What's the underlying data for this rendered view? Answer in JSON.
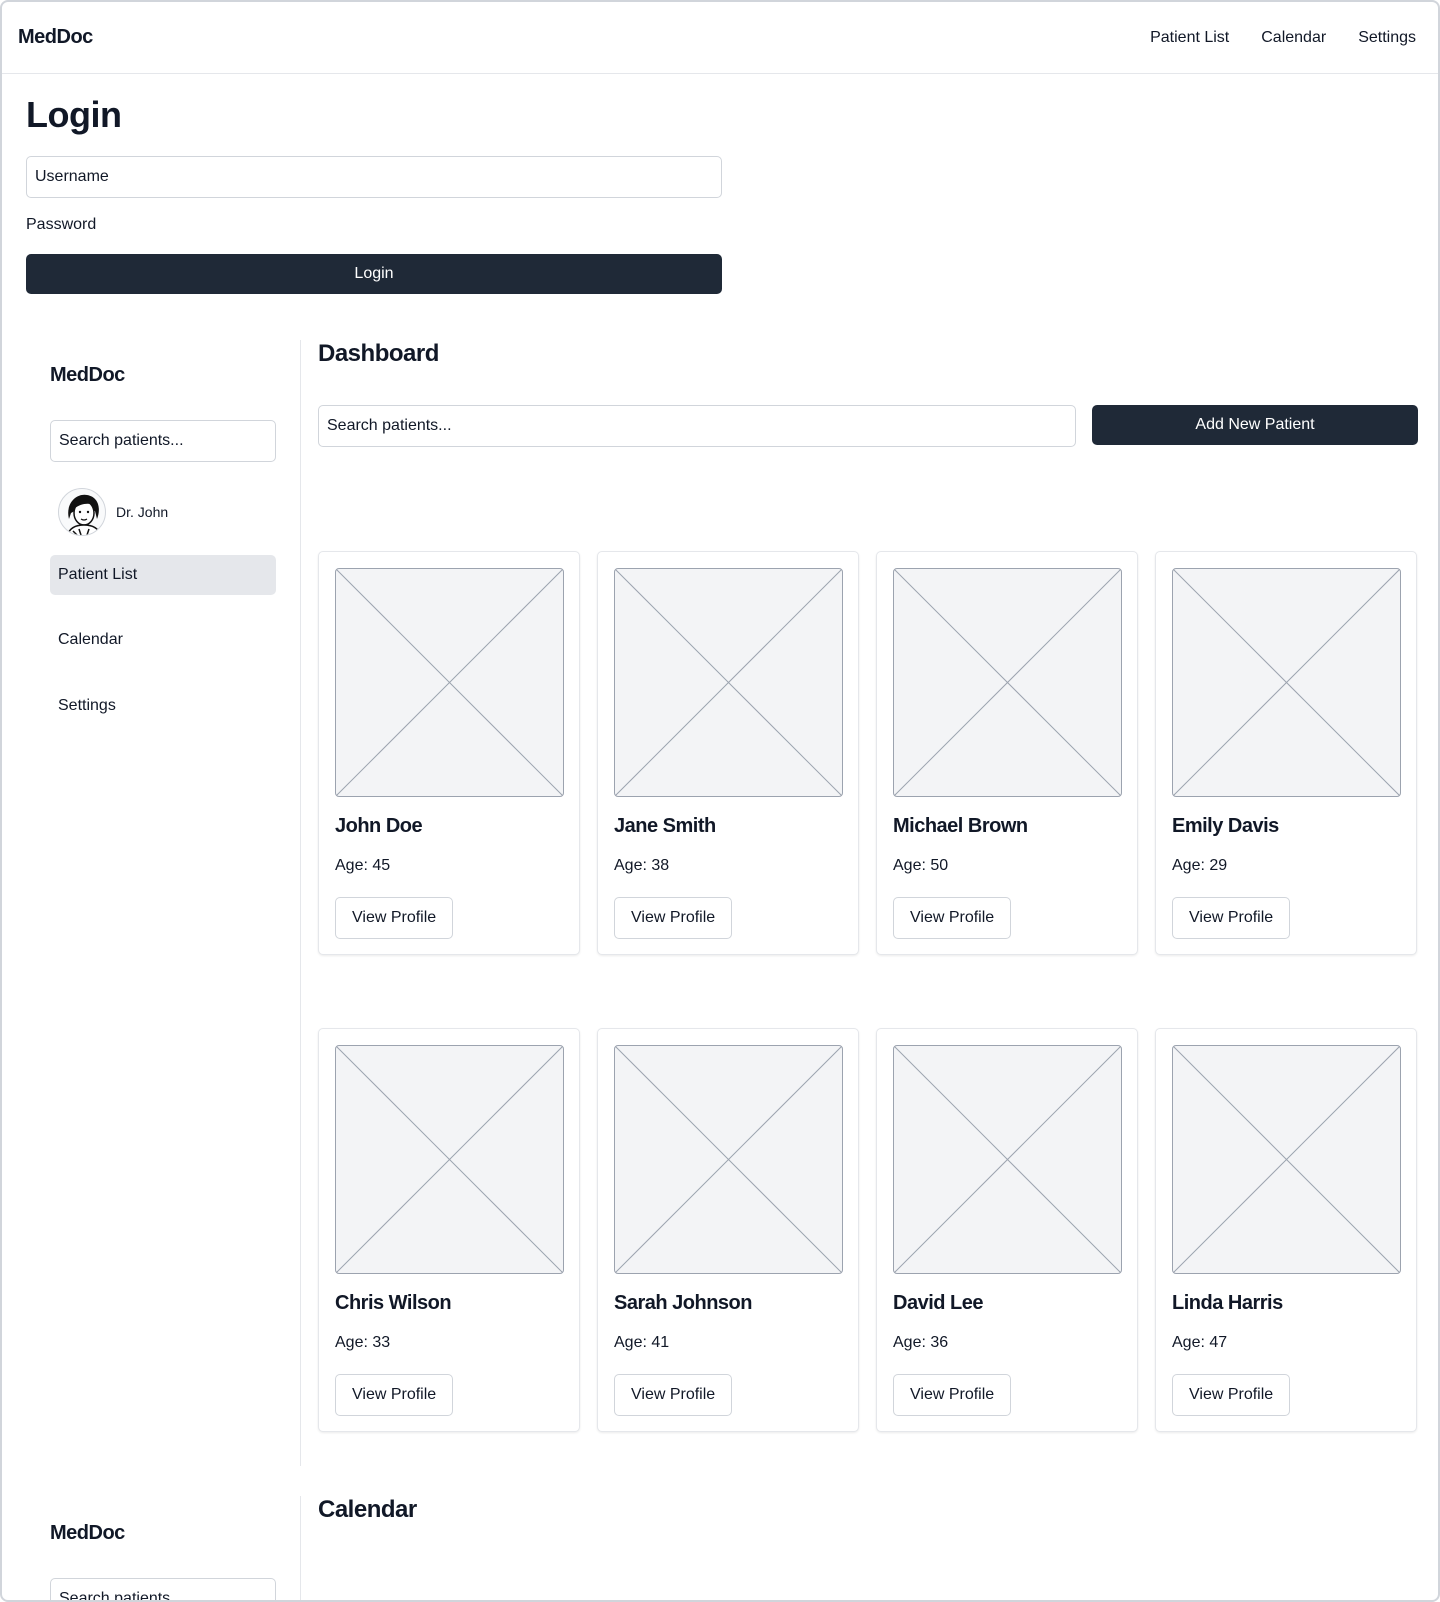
{
  "topnav": {
    "brand": "MedDoc",
    "links": [
      "Patient List",
      "Calendar",
      "Settings"
    ]
  },
  "login": {
    "title": "Login",
    "username_placeholder": "Username",
    "password_label": "Password",
    "button_label": "Login"
  },
  "sidebar": {
    "brand": "MedDoc",
    "search_placeholder": "Search patients...",
    "user_name": "Dr. John",
    "items": [
      {
        "label": "Patient List",
        "active": true
      },
      {
        "label": "Calendar",
        "active": false
      },
      {
        "label": "Settings",
        "active": false
      }
    ]
  },
  "dashboard": {
    "title": "Dashboard",
    "search_placeholder": "Search patients...",
    "add_button_label": "Add New Patient",
    "view_profile_label": "View Profile",
    "patients": [
      {
        "name": "John Doe",
        "age": "Age: 45"
      },
      {
        "name": "Jane Smith",
        "age": "Age: 38"
      },
      {
        "name": "Michael Brown",
        "age": "Age: 50"
      },
      {
        "name": "Emily Davis",
        "age": "Age: 29"
      },
      {
        "name": "Chris Wilson",
        "age": "Age: 33"
      },
      {
        "name": "Sarah Johnson",
        "age": "Age: 41"
      },
      {
        "name": "David Lee",
        "age": "Age: 36"
      },
      {
        "name": "Linda Harris",
        "age": "Age: 47"
      }
    ]
  },
  "calendar_section": {
    "sidebar_brand": "MedDoc",
    "sidebar_search_placeholder": "Search patients...",
    "title": "Calendar"
  },
  "colors": {
    "primary_button": "#1f2937",
    "active_item_bg": "#e5e7eb",
    "border": "#d1d5db",
    "placeholder_image_bg": "#f3f4f6"
  },
  "icons": {
    "avatar": "doctor-avatar-icon",
    "card_image": "image-placeholder-icon"
  }
}
